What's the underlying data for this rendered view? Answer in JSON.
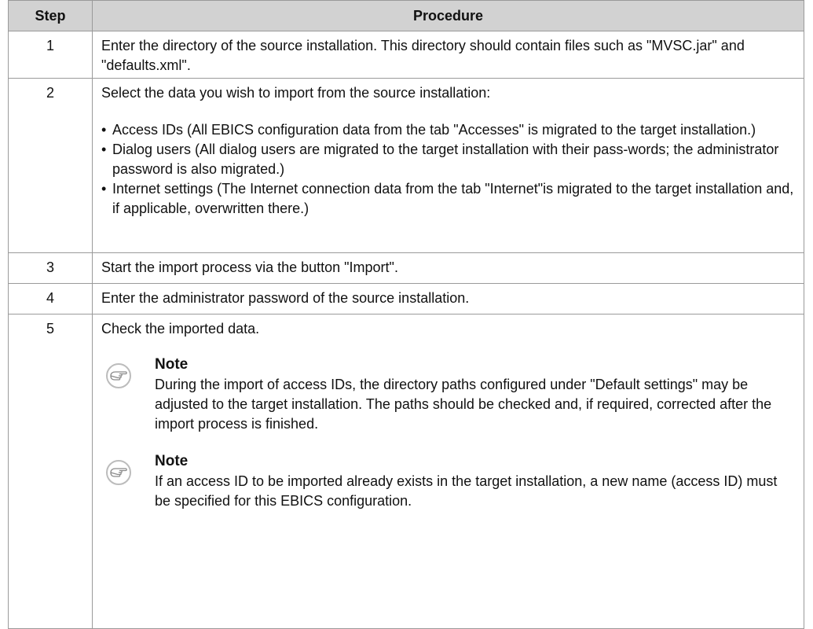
{
  "headers": {
    "step": "Step",
    "procedure": "Procedure"
  },
  "rows": [
    {
      "step": "1",
      "text": "Enter the directory of the source installation. This directory should contain files such as \"MVSC.jar\" and \"defaults.xml\"."
    },
    {
      "step": "2",
      "text": "Select the data you wish to import from the source installation:",
      "bullets": [
        "Access IDs (All EBICS configuration data from the tab \"Accesses\" is migrated to the target installation.)",
        "Dialog users (All dialog users are migrated to the target installation with their pass-words; the administrator password is also migrated.)",
        "Internet settings (The Internet connection data from the tab \"Internet\"is migrated to the target installation and, if applicable, overwritten there.)"
      ]
    },
    {
      "step": "3",
      "text": "Start the import process via the button \"Import\"."
    },
    {
      "step": "4",
      "text": "Enter the administrator password of the source installation."
    },
    {
      "step": "5",
      "text": "Check the imported data.",
      "notes": [
        {
          "title": "Note",
          "icon": "pointing-hand-icon",
          "text": "During the import of access IDs, the directory paths configured under \"Default settings\" may be adjusted to the target installation. The paths should be checked and, if required, corrected after the import process is finished."
        },
        {
          "title": "Note",
          "icon": "pointing-hand-icon",
          "text": "If an access ID to be imported already exists in the target installation, a new name (access ID) must be specified for this EBICS configuration."
        }
      ]
    }
  ]
}
